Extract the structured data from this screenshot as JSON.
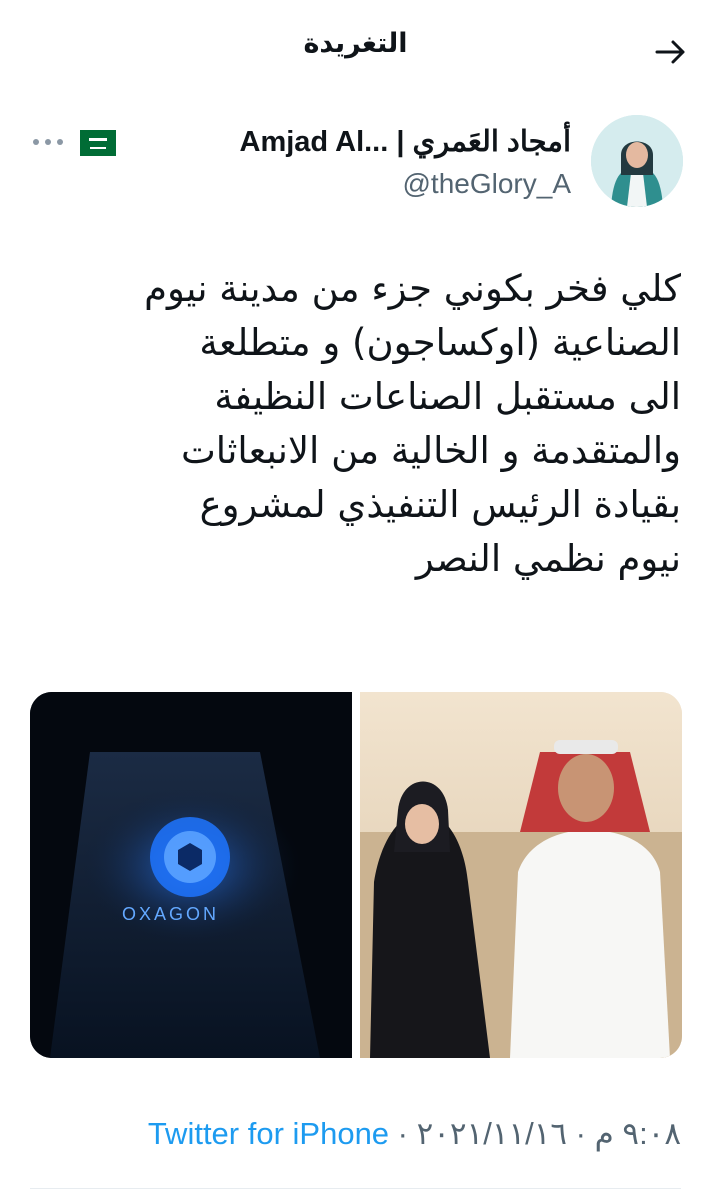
{
  "header": {
    "title": "التغريدة",
    "back_icon": "arrow-right-icon"
  },
  "author": {
    "display_name": "Amjad Al... | أمجاد العَمري",
    "handle": "@theGlory_A",
    "flag_icon": "saudi-flag-icon",
    "more_icon": "more-horizontal-icon"
  },
  "tweet": {
    "lines": [
      "كلي فخر بكوني جزء من مدينة نيوم",
      "الصناعية (اوكساجون) و متطلعة",
      "الى مستقبل الصناعات النظيفة",
      "والمتقدمة و الخالية من الانبعاثات",
      "بقيادة الرئيس التنفيذي لمشروع",
      "نيوم نظمي النصر"
    ]
  },
  "media": {
    "left_image_text": "OXAGON"
  },
  "meta": {
    "date": "٢٠٢١/١١/١٦",
    "separator": " · ",
    "time": "٩:٠٨ م",
    "source": "Twitter for iPhone"
  },
  "colors": {
    "link": "#1d9bf0",
    "secondary_text": "#536471",
    "primary_text": "#0f1419"
  }
}
